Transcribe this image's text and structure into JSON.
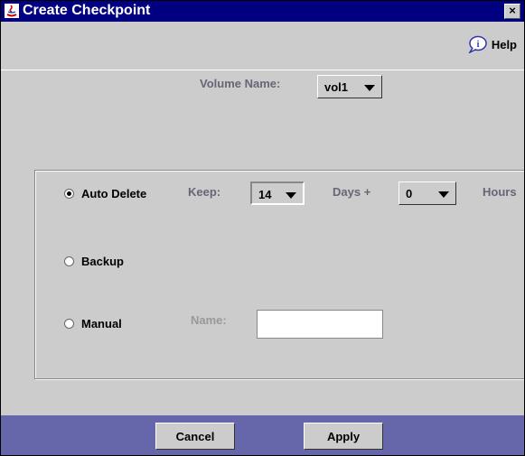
{
  "window": {
    "title": "Create Checkpoint"
  },
  "toolbar": {
    "help_label": "Help"
  },
  "volume": {
    "label": "Volume Name:",
    "selected": "vol1"
  },
  "options": {
    "auto_delete": {
      "label": "Auto Delete",
      "selected": true
    },
    "keep_label": "Keep:",
    "days_value": "14",
    "days_label": "Days +",
    "hours_value": "0",
    "hours_label": "Hours",
    "backup": {
      "label": "Backup",
      "selected": false
    },
    "manual": {
      "label": "Manual",
      "selected": false
    },
    "name_label": "Name:",
    "name_value": ""
  },
  "buttons": {
    "cancel": "Cancel",
    "apply": "Apply"
  },
  "colors": {
    "titlebar": "#000080",
    "footer": "#6666aa",
    "window": "#cccccc"
  }
}
